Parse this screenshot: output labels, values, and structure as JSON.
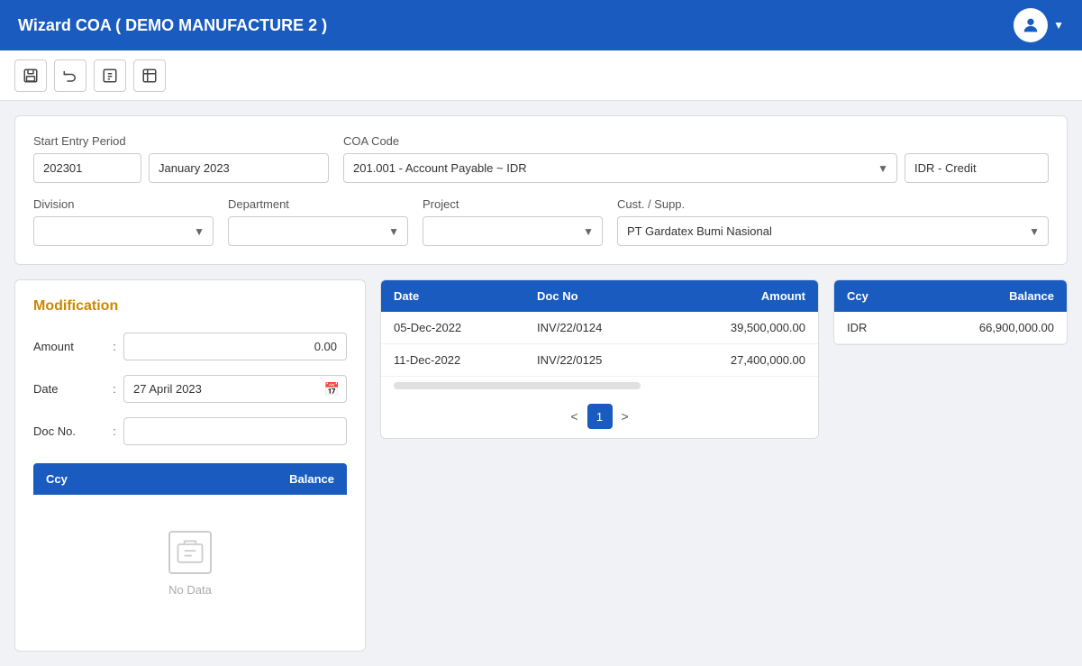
{
  "header": {
    "title": "Wizard COA ( DEMO MANUFACTURE 2 )"
  },
  "toolbar": {
    "buttons": [
      {
        "name": "save-btn",
        "icon": "💾",
        "label": "Save"
      },
      {
        "name": "undo-btn",
        "icon": "↩",
        "label": "Undo"
      },
      {
        "name": "edit-btn",
        "icon": "✏",
        "label": "Edit"
      },
      {
        "name": "export-btn",
        "icon": "⬜",
        "label": "Export"
      }
    ]
  },
  "form": {
    "start_entry_period_label": "Start Entry Period",
    "period_code": "202301",
    "period_name": "January 2023",
    "coa_code_label": "COA Code",
    "coa_value": "201.001 - Account Payable ~ IDR",
    "coa_type": "IDR - Credit",
    "division_label": "Division",
    "division_placeholder": "",
    "department_label": "Department",
    "department_placeholder": "",
    "project_label": "Project",
    "project_placeholder": "",
    "cust_supp_label": "Cust. / Supp.",
    "cust_supp_value": "PT Gardatex Bumi Nasional"
  },
  "modification": {
    "title": "Modification",
    "amount_label": "Amount",
    "amount_value": "0.00",
    "date_label": "Date",
    "date_value": "27 April 2023",
    "doc_no_label": "Doc No.",
    "doc_no_value": "",
    "ccy_col": "Ccy",
    "balance_col": "Balance",
    "no_data_text": "No Data"
  },
  "transactions": {
    "columns": [
      {
        "key": "date",
        "label": "Date"
      },
      {
        "key": "doc_no",
        "label": "Doc No"
      },
      {
        "key": "amount",
        "label": "Amount",
        "align": "right"
      }
    ],
    "rows": [
      {
        "date": "05-Dec-2022",
        "doc_no": "INV/22/0124",
        "amount": "39,500,000.00"
      },
      {
        "date": "11-Dec-2022",
        "doc_no": "INV/22/0125",
        "amount": "27,400,000.00"
      }
    ],
    "pagination": {
      "current_page": 1,
      "prev_label": "<",
      "next_label": ">"
    }
  },
  "ccy_balance": {
    "ccy_col": "Ccy",
    "balance_col": "Balance",
    "rows": [
      {
        "ccy": "IDR",
        "balance": "66,900,000.00"
      }
    ]
  }
}
